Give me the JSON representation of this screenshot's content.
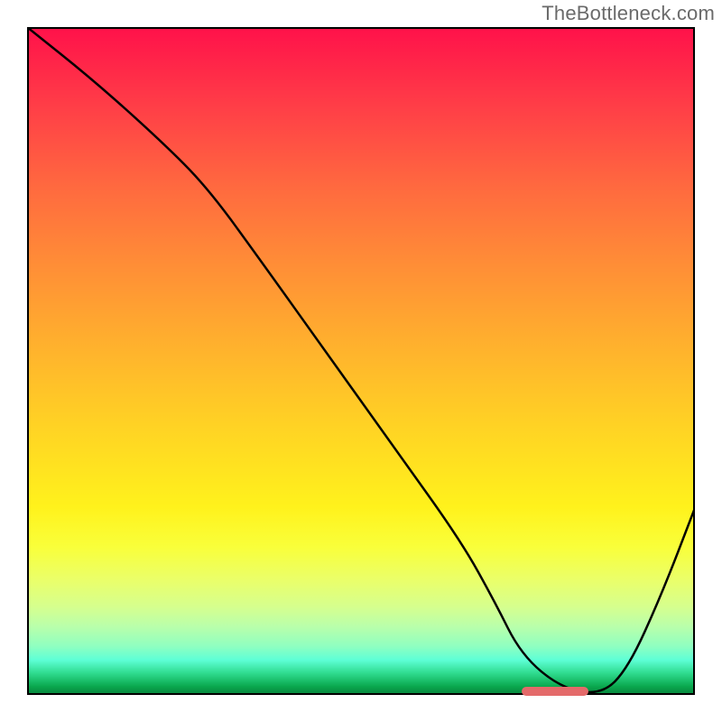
{
  "watermark": "TheBottleneck.com",
  "chart_data": {
    "type": "line",
    "title": "",
    "xlabel": "",
    "ylabel": "",
    "xlim": [
      0,
      100
    ],
    "ylim": [
      0,
      100
    ],
    "x": [
      0,
      10,
      20,
      27,
      35,
      45,
      55,
      65,
      70,
      74,
      80,
      86,
      90,
      95,
      100
    ],
    "y": [
      100,
      92,
      83,
      76,
      65,
      51,
      37,
      23,
      14,
      6,
      1,
      0,
      4,
      15,
      28
    ],
    "notes": "Black curve is a bottleneck-ratio curve; y is mismatch percentage (high=red) against some ratio x. Minimum around x≈78-86.",
    "optimal_band": {
      "x_start": 74,
      "x_end": 84,
      "y": 0.5
    },
    "colors": {
      "curve": "#000000",
      "optimal_marker": "#e46a6a",
      "gradient_top": "#ff124a",
      "gradient_mid": "#ffd324",
      "gradient_bottom": "#088a3f"
    }
  }
}
